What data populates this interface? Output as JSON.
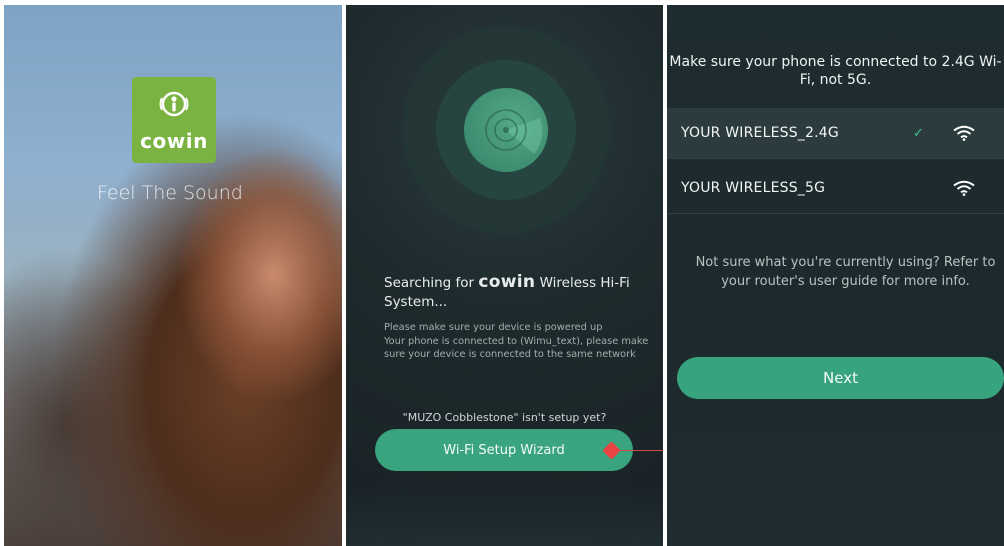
{
  "splash": {
    "logo_text": "cowin",
    "tagline": "Feel The Sound"
  },
  "search": {
    "title_prefix": "Searching for",
    "brand": "cowin",
    "title_suffix": "Wireless Hi-Fi System...",
    "hint_line1": "Please make sure your device is powered up",
    "hint_line2": "Your phone is connected to (Wimu_text), please make sure your device is connected to the same network",
    "not_setup": "\"MUZO Cobblestone\" isn't setup yet?",
    "wizard_button": "Wi-Fi Setup Wizard",
    "accent_color": "#3aa47f",
    "marker_color": "#ea4343"
  },
  "wifi": {
    "note": "Make sure your phone is connected to 2.4G Wi-Fi, not 5G.",
    "networks": [
      {
        "ssid": "YOUR WIRELESS_2.4G",
        "selected": true,
        "icon": "wifi-icon"
      },
      {
        "ssid": "YOUR WIRELESS_5G",
        "selected": false,
        "icon": "wifi-icon"
      }
    ],
    "check_mark": "✓",
    "unsure_text": "Not sure what you're currently using? Refer to your router's user guide for more info.",
    "next_button": "Next"
  }
}
